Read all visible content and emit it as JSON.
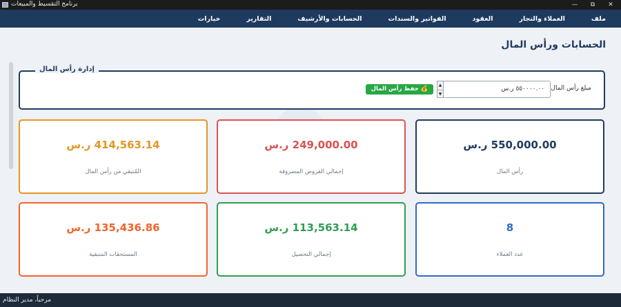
{
  "window": {
    "title": "برنامج التقسيط والمبيعات",
    "minimize": "—",
    "maximize": "⧉",
    "close": "✕"
  },
  "menu": [
    "ملف",
    "العملاء والتجار",
    "العقود",
    "الفواتير والسندات",
    "الحسابات والأرشيف",
    "التقارير",
    "خيارات"
  ],
  "page": {
    "title": "الحسابات ورأس المال"
  },
  "capital": {
    "legend": "إدارة رأس المال",
    "label": "مبلغ رأس المال:",
    "value": "٥٥٠٠٠٠.٠٠ ر.س",
    "spin_up": "▲",
    "spin_down": "▼",
    "save_button": "💰 حفظ رأس المال"
  },
  "cards": [
    {
      "value": "550,000.00 ر.س",
      "label": "رأس المال",
      "color": "#1f3a5f"
    },
    {
      "value": "249,000.00 ر.س",
      "label": "إجمالي القروض المصروفة",
      "color": "#d9534f"
    },
    {
      "value": "414,563.14 ر.س",
      "label": "المُتبقي من رأس المال",
      "color": "#e69522"
    },
    {
      "value": "8",
      "label": "عدد العملاء",
      "color": "#2d6bc4"
    },
    {
      "value": "113,563.14 ر.س",
      "label": "إجمالي التحصيل",
      "color": "#2e9d52"
    },
    {
      "value": "135,436.86 ر.س",
      "label": "المستحقات المتبقية",
      "color": "#f0642a"
    }
  ],
  "status": {
    "text": "مرحباً، مدير النظام"
  }
}
